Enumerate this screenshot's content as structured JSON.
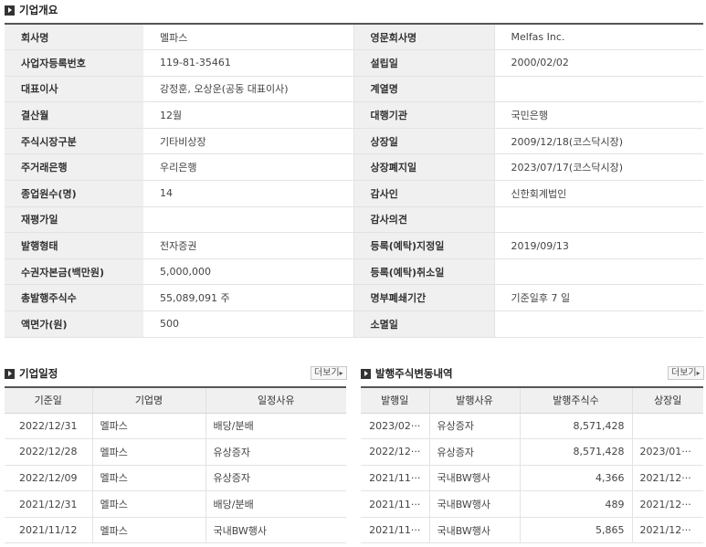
{
  "overview": {
    "title": "기업개요",
    "rows": [
      [
        "회사명",
        "멜파스",
        "영문회사명",
        "Melfas Inc."
      ],
      [
        "사업자등록번호",
        "119-81-35461",
        "설립일",
        "2000/02/02"
      ],
      [
        "대표이사",
        "강정훈, 오상운(공동 대표이사)",
        "계열명",
        ""
      ],
      [
        "결산월",
        "12월",
        "대행기관",
        "국민은행"
      ],
      [
        "주식시장구분",
        "기타비상장",
        "상장일",
        "2009/12/18(코스닥시장)"
      ],
      [
        "주거래은행",
        "우리은행",
        "상장폐지일",
        "2023/07/17(코스닥시장)"
      ],
      [
        "종업원수(명)",
        "14",
        "감사인",
        "신한회계법인"
      ],
      [
        "재평가일",
        "",
        "감사의견",
        ""
      ],
      [
        "발행형태",
        "전자증권",
        "등록(예탁)지정일",
        "2019/09/13"
      ],
      [
        "수권자본금(백만원)",
        "5,000,000",
        "등록(예탁)취소일",
        ""
      ],
      [
        "총발행주식수",
        "55,089,091 주",
        "명부폐쇄기간",
        "기준일후 7 일"
      ],
      [
        "액면가(원)",
        "500",
        "소멸일",
        ""
      ]
    ]
  },
  "schedule": {
    "title": "기업일정",
    "more_label": "더보기",
    "headers": [
      "기준일",
      "기업명",
      "일정사유"
    ],
    "rows": [
      [
        "2022/12/31",
        "멜파스",
        "배당/분배"
      ],
      [
        "2022/12/28",
        "멜파스",
        "유상증자"
      ],
      [
        "2022/12/09",
        "멜파스",
        "유상증자"
      ],
      [
        "2021/12/31",
        "멜파스",
        "배당/분배"
      ],
      [
        "2021/11/12",
        "멜파스",
        "국내BW행사"
      ]
    ]
  },
  "issuance": {
    "title": "발행주식변동내역",
    "more_label": "더보기",
    "headers": [
      "발행일",
      "발행사유",
      "발행주식수",
      "상장일"
    ],
    "rows": [
      [
        "2023/02···",
        "유상증자",
        "8,571,428",
        ""
      ],
      [
        "2022/12···",
        "유상증자",
        "8,571,428",
        "2023/01···"
      ],
      [
        "2021/11···",
        "국내BW행사",
        "4,366",
        "2021/12···"
      ],
      [
        "2021/11···",
        "국내BW행사",
        "489",
        "2021/12···"
      ],
      [
        "2021/11···",
        "국내BW행사",
        "5,865",
        "2021/12···"
      ]
    ]
  }
}
